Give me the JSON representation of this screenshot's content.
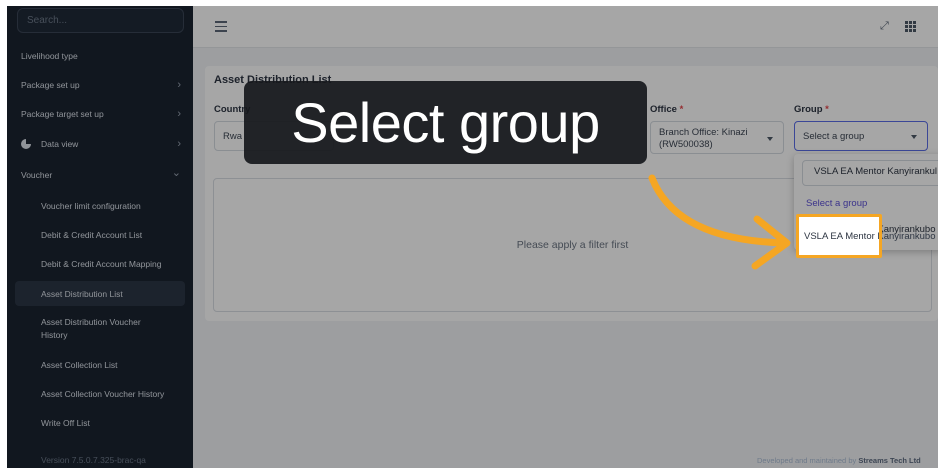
{
  "sidebar": {
    "search_placeholder": "Search...",
    "items": [
      {
        "label": "Livelihood type",
        "has_chevron": false
      },
      {
        "label": "Package set up",
        "chevron": "›"
      },
      {
        "label": "Package target set up",
        "chevron": "›"
      },
      {
        "label": "Data view",
        "icon": "pie-chart-icon",
        "chevron": "›"
      },
      {
        "label": "Voucher",
        "chevron": "⌄"
      }
    ],
    "sub_items": [
      "Voucher limit configuration",
      "Debit & Credit Account List",
      "Debit & Credit Account Mapping",
      "Asset Distribution List",
      "Asset Distribution Voucher History",
      "Asset Collection List",
      "Asset Collection Voucher History",
      "Write Off List"
    ],
    "active_sub": "Asset Distribution List",
    "version": "Version 7.5.0.7.325-brac-qa"
  },
  "topbar": {
    "menu_icon": "hamburger-icon",
    "expand_icon": "fullscreen-icon",
    "apps_icon": "grid-icon"
  },
  "main": {
    "title": "Asset Distribution List",
    "filters": {
      "country_label": "Country",
      "country_value": "Rwa",
      "office_label": "Office",
      "office_value_line1": "Branch Office: Kinazi",
      "office_value_line2": "(RW500038)",
      "group_label": "Group",
      "group_placeholder": "Select a group",
      "required_mark": "*"
    },
    "empty_message": "Please apply a filter first"
  },
  "dropdown": {
    "option_top": "VSLA EA Mentor Kanyirankul",
    "placeholder": "Select a group",
    "option_highlight": "VSLA EA Mentor Kanyirankubo"
  },
  "tooltip": {
    "text": "Select group"
  },
  "footer": {
    "prefix": "Developed and maintained by ",
    "company": "Streams Tech Ltd"
  },
  "colors": {
    "accent": "#f5a623",
    "sidebar_bg": "#1b2431",
    "tooltip_bg": "#16181c",
    "link_purple": "#5b4fd6",
    "required_red": "#e5484d"
  }
}
